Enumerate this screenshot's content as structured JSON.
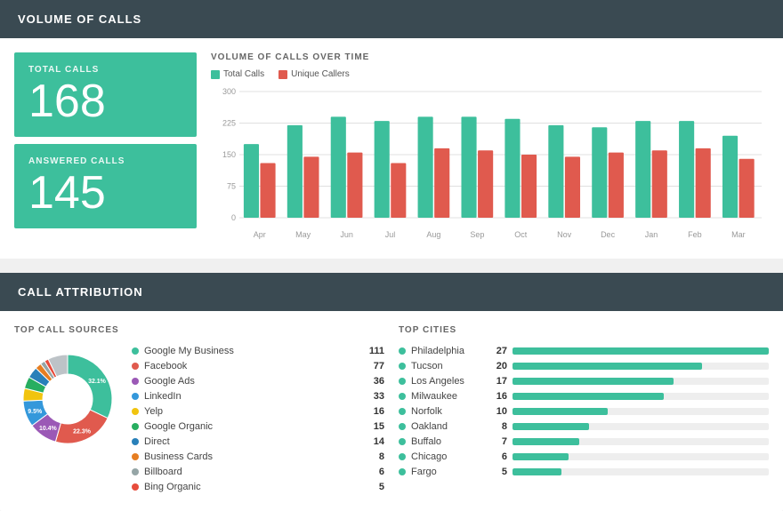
{
  "page": {
    "bg_color": "#f0f0f0"
  },
  "volume_section": {
    "header": "VOLUME OF CALLS",
    "total_calls_label": "TOTAL CALLS",
    "total_calls_value": "168",
    "answered_calls_label": "ANSWERED CALLS",
    "answered_calls_value": "145",
    "chart_title": "VOLUME OF CALLS OVER TIME",
    "legend": {
      "total_calls": "Total Calls",
      "unique_callers": "Unique Callers"
    },
    "chart_colors": {
      "total": "#3dbf9c",
      "unique": "#e05a4e"
    },
    "y_labels": [
      "300",
      "225",
      "150",
      "75",
      "0"
    ],
    "months": [
      "Apr",
      "May",
      "Jun",
      "Jul",
      "Aug",
      "Sep",
      "Oct",
      "Nov",
      "Dec",
      "Jan",
      "Feb",
      "Mar"
    ],
    "total_data": [
      175,
      220,
      240,
      230,
      240,
      240,
      235,
      220,
      215,
      230,
      230,
      195
    ],
    "unique_data": [
      130,
      145,
      155,
      130,
      165,
      160,
      150,
      145,
      155,
      160,
      165,
      140
    ]
  },
  "attribution_section": {
    "header": "CALL ATTRIBUTION",
    "sources_title": "TOP CALL SOURCES",
    "sources": [
      {
        "name": "Google My Business",
        "count": "111",
        "color": "#3dbf9c"
      },
      {
        "name": "Facebook",
        "count": "77",
        "color": "#e05a4e"
      },
      {
        "name": "Google Ads",
        "count": "36",
        "color": "#9b59b6"
      },
      {
        "name": "LinkedIn",
        "count": "33",
        "color": "#3498db"
      },
      {
        "name": "Yelp",
        "count": "16",
        "color": "#f1c40f"
      },
      {
        "name": "Google Organic",
        "count": "15",
        "color": "#27ae60"
      },
      {
        "name": "Direct",
        "count": "14",
        "color": "#2980b9"
      },
      {
        "name": "Business Cards",
        "count": "8",
        "color": "#e67e22"
      },
      {
        "name": "Billboard",
        "count": "6",
        "color": "#95a5a6"
      },
      {
        "name": "Bing Organic",
        "count": "5",
        "color": "#e74c3c"
      }
    ],
    "donut": {
      "segments": [
        {
          "pct": 32.1,
          "color": "#3dbf9c",
          "label": "32.1%"
        },
        {
          "pct": 22.3,
          "color": "#e05a4e",
          "label": "22.3%"
        },
        {
          "pct": 10.4,
          "color": "#9b59b6",
          "label": "10.4%"
        },
        {
          "pct": 9.5,
          "color": "#3498db",
          "label": "9.5%"
        },
        {
          "pct": 4.6,
          "color": "#f1c40f"
        },
        {
          "pct": 4.3,
          "color": "#27ae60"
        },
        {
          "pct": 4.1,
          "color": "#2980b9"
        },
        {
          "pct": 2.3,
          "color": "#e67e22"
        },
        {
          "pct": 1.7,
          "color": "#95a5a6"
        },
        {
          "pct": 1.5,
          "color": "#e74c3c"
        },
        {
          "pct": 7.2,
          "color": "#bdc3c7"
        }
      ]
    },
    "cities_title": "TOP CITIES",
    "cities": [
      {
        "name": "Philadelphia",
        "count": "27",
        "pct": 100
      },
      {
        "name": "Tucson",
        "count": "20",
        "pct": 74
      },
      {
        "name": "Los Angeles",
        "count": "17",
        "pct": 63
      },
      {
        "name": "Milwaukee",
        "count": "16",
        "pct": 59
      },
      {
        "name": "Norfolk",
        "count": "10",
        "pct": 37
      },
      {
        "name": "Oakland",
        "count": "8",
        "pct": 30
      },
      {
        "name": "Buffalo",
        "count": "7",
        "pct": 26
      },
      {
        "name": "Chicago",
        "count": "6",
        "pct": 22
      },
      {
        "name": "Fargo",
        "count": "5",
        "pct": 19
      }
    ]
  }
}
